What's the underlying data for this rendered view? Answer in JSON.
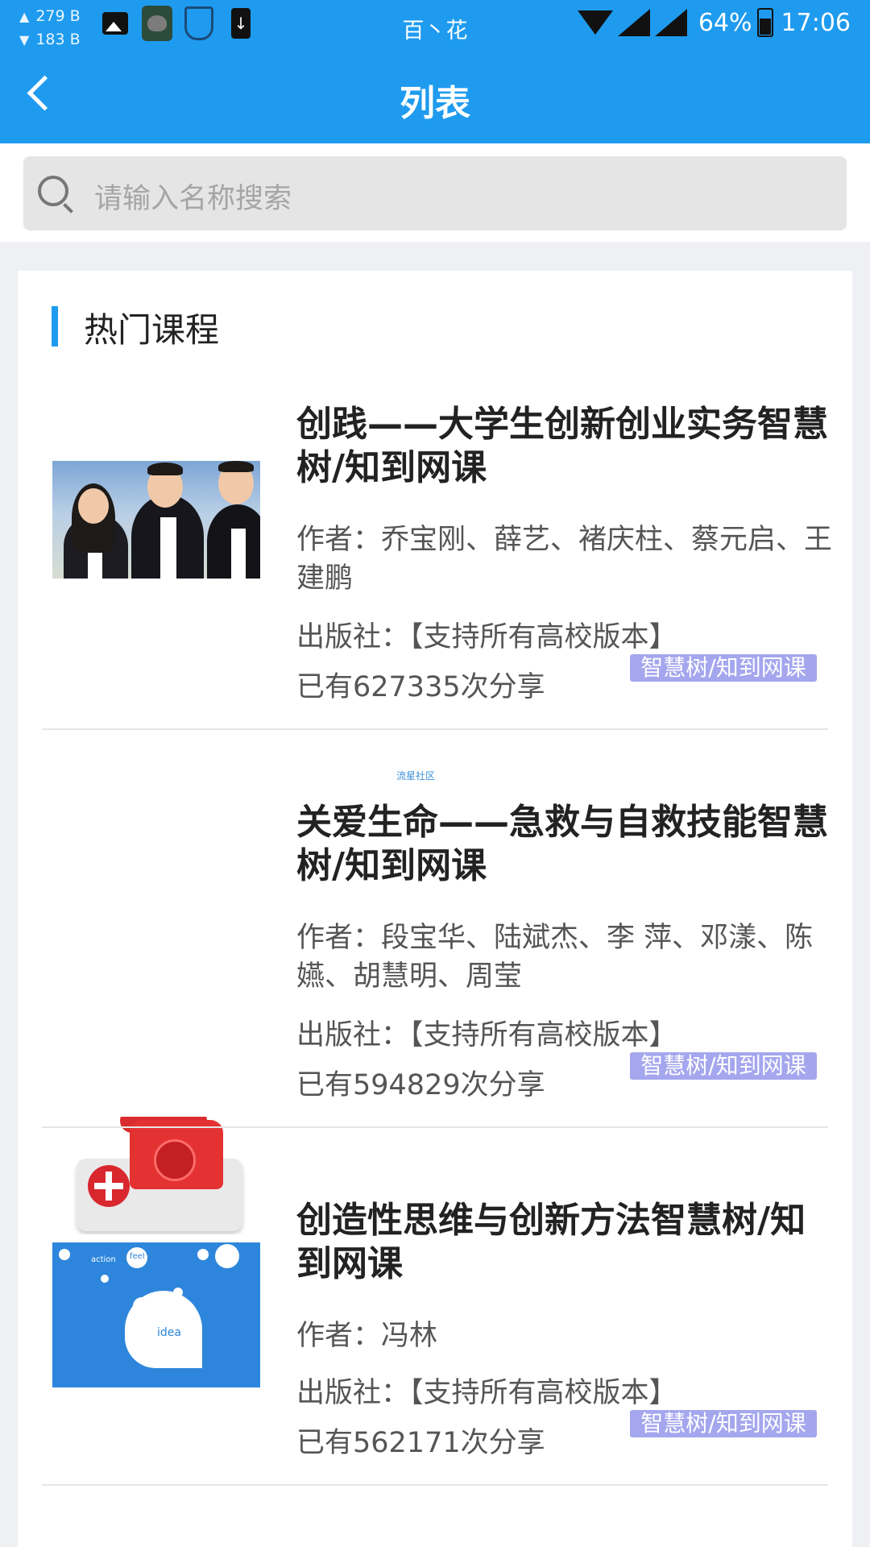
{
  "status_bar": {
    "net_up": "279 B",
    "net_down": "183 B",
    "carrier": "百丶花",
    "battery": "64%",
    "time": "17:06"
  },
  "header": {
    "title": "列表",
    "back_icon": "chevron-left-icon"
  },
  "search": {
    "placeholder": "请输入名称搜索",
    "icon": "search-icon"
  },
  "section": {
    "title": "热门课程"
  },
  "courses": [
    {
      "name": "创践——大学生创新创业实务智慧树/知到网课",
      "author": "作者：乔宝刚、薛艺、褚庆柱、蔡元启、王建鹏",
      "publisher": "出版社：【支持所有高校版本】",
      "shares": "已有627335次分享",
      "tag": "智慧树/知到网课"
    },
    {
      "name": "关爱生命——急救与自救技能智慧树/知到网课",
      "author": "作者：段宝华、陆斌杰、李 萍、邓漾、陈嬿、胡慧明、周莹",
      "publisher": "出版社：【支持所有高校版本】",
      "shares": "已有594829次分享",
      "tag": "智慧树/知到网课"
    },
    {
      "name": "创造性思维与创新方法智慧树/知到网课",
      "author": "作者：冯林",
      "publisher": "出版社：【支持所有高校版本】",
      "shares": "已有562171次分享",
      "tag": "智慧树/知到网课"
    }
  ],
  "watermark": "流星社区",
  "thumb3_labels": {
    "action": "action",
    "feel": "feel",
    "idea": "idea"
  },
  "colors": {
    "accent": "#1e9bef",
    "tag_bg": "#a4a6ee"
  }
}
